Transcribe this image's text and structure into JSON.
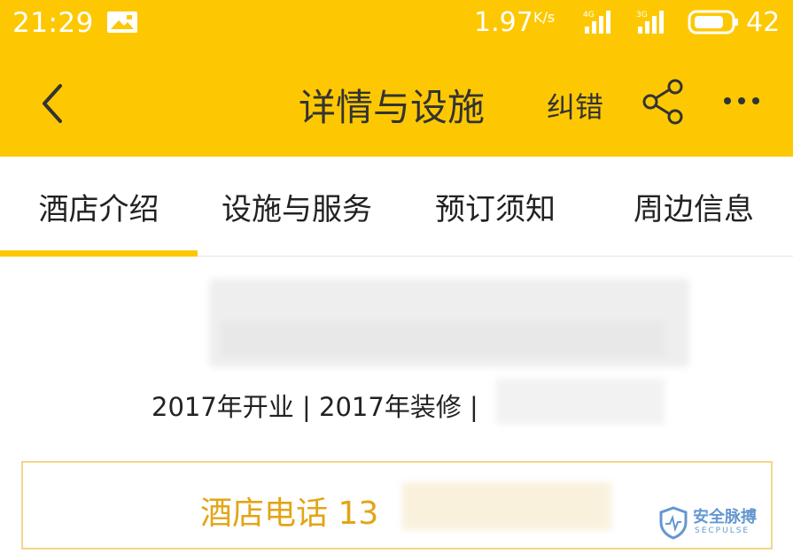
{
  "status_bar": {
    "time": "21:29",
    "network_speed": "1.97",
    "speed_unit": "K/s",
    "signal1_label": "4G",
    "signal2_label": "3G",
    "battery": "42"
  },
  "header": {
    "title": "详情与设施",
    "correct_label": "纠错"
  },
  "tabs": [
    {
      "label": "酒店介绍",
      "active": true
    },
    {
      "label": "设施与服务",
      "active": false
    },
    {
      "label": "预订须知",
      "active": false
    },
    {
      "label": "周边信息",
      "active": false
    }
  ],
  "hotel_info": {
    "opening_info": "2017年开业 | 2017年装修 |"
  },
  "phone": {
    "label": "酒店电话 13"
  },
  "watermark": {
    "text": "安全脉搏",
    "sub": "SECPULSE"
  },
  "colors": {
    "header_bg": "#fdc802",
    "accent": "#e2a515",
    "phone_border": "#f3d689"
  }
}
